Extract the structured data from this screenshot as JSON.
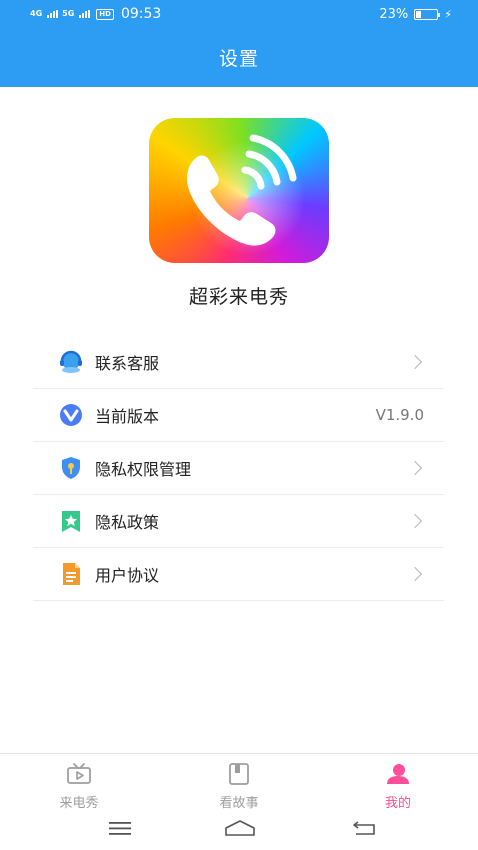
{
  "status_bar": {
    "network_1": "4G",
    "network_2": "5G",
    "hd_badge": "HD",
    "time": "09:53",
    "battery_percent_text": "23%",
    "battery_level": 0.23
  },
  "header": {
    "title": "设置"
  },
  "app": {
    "name": "超彩来电秀",
    "icon": "phone-ringing-icon"
  },
  "settings": {
    "items": [
      {
        "label": "联系客服",
        "icon": "customer-service-icon",
        "value": ""
      },
      {
        "label": "当前版本",
        "icon": "version-icon",
        "value": "V1.9.0"
      },
      {
        "label": "隐私权限管理",
        "icon": "privacy-shield-icon",
        "value": ""
      },
      {
        "label": "隐私政策",
        "icon": "policy-star-icon",
        "value": ""
      },
      {
        "label": "用户协议",
        "icon": "agreement-document-icon",
        "value": ""
      }
    ]
  },
  "bottom_nav": {
    "tabs": [
      {
        "label": "来电秀",
        "icon": "tv-play-icon",
        "active": false
      },
      {
        "label": "看故事",
        "icon": "book-icon",
        "active": false
      },
      {
        "label": "我的",
        "icon": "profile-icon",
        "active": true
      }
    ]
  },
  "colors": {
    "header_blue": "#2d9cf3",
    "active_pink": "#ff4f9a",
    "inactive_gray": "#9e9e9e"
  }
}
